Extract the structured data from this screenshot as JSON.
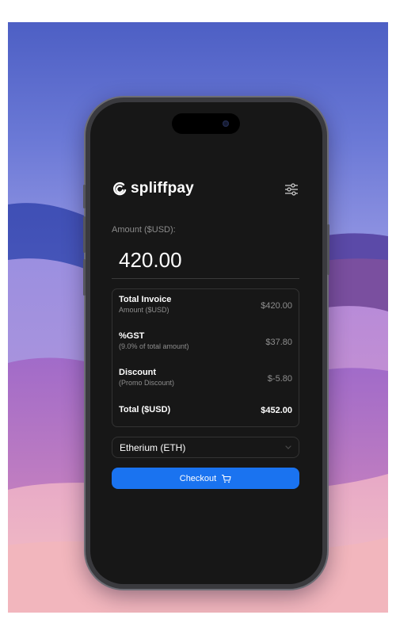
{
  "brand": {
    "name": "spliffpay",
    "logo_icon": "swirl-logo-icon",
    "settings_icon": "sliders-icon"
  },
  "amount": {
    "label": "Amount ($USD):",
    "value": "420.00"
  },
  "summary": {
    "rows": [
      {
        "title": "Total Invoice",
        "subtitle": "Amount ($USD)",
        "value": "$420.00"
      },
      {
        "title": "%GST",
        "subtitle": "(9.0% of total amount)",
        "value": "$37.80"
      },
      {
        "title": "Discount",
        "subtitle": "(Promo Discount)",
        "value": "$-5.80"
      }
    ],
    "total": {
      "title": "Total ($USD)",
      "value": "$452.00"
    }
  },
  "currency": {
    "selected": "Etherium (ETH)",
    "icon": "chevron-down-icon"
  },
  "checkout": {
    "label": "Checkout",
    "icon": "cart-icon"
  },
  "colors": {
    "screen_bg": "#171717",
    "accent": "#1a73f0",
    "text_primary": "#ffffff",
    "text_muted": "#8e8e8e"
  }
}
